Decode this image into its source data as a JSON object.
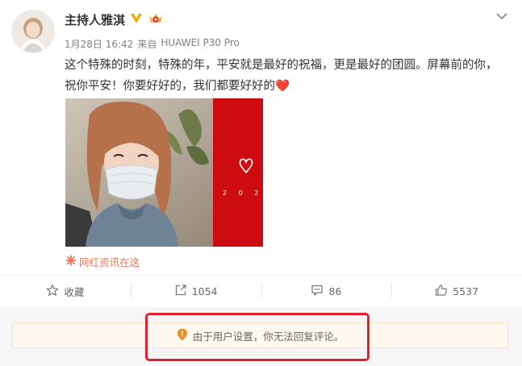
{
  "post": {
    "author": "主持人雅淇",
    "time": "1月28日 16:42",
    "source_prefix": "来自",
    "source_device": "HUAWEI P30 Pro",
    "text": "这个特殊的时刻，特殊的年，平安就是最好的祝福，更是最好的团圆。屏幕前的你，祝你平安！你要好好的，我们都要好好的",
    "text_emoji": "❤️",
    "image_caption": "2 0 2",
    "link_label": "网红资讯在这"
  },
  "actions": {
    "favorite_label": "收藏",
    "repost_count": "1054",
    "comment_count": "86",
    "like_count": "5537"
  },
  "notice": {
    "text": "由于用户设置，你无法回复评论。"
  },
  "colors": {
    "brand_orange": "#eb7350",
    "verified_gold": "#f7a600",
    "highlight_red": "#e5202e",
    "photo_red": "#cc0c10"
  }
}
